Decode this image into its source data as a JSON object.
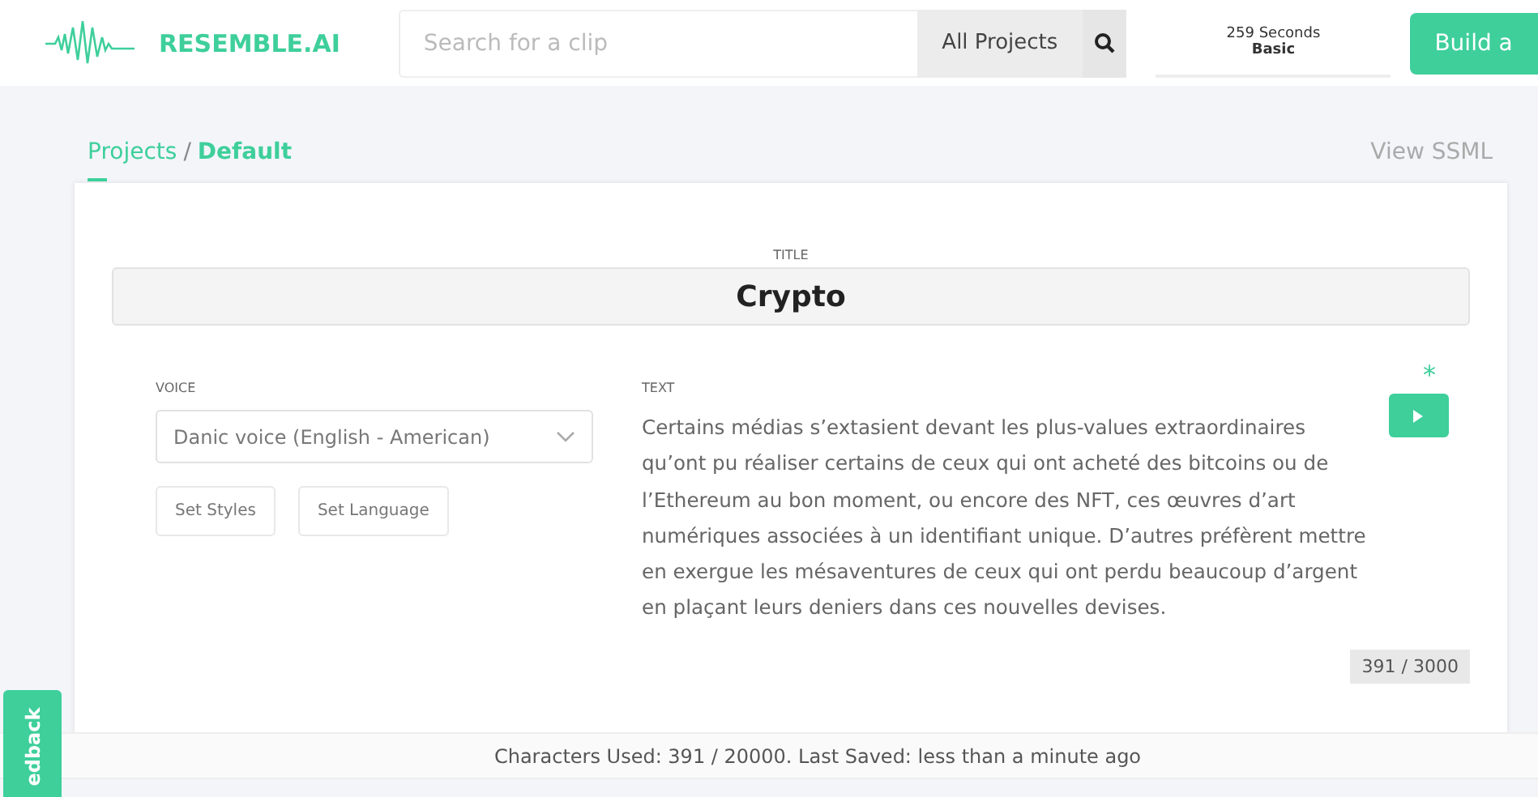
{
  "header": {
    "logo": "RESEMBLE.AI",
    "search": {
      "placeholder": "Search for a clip"
    },
    "scope": "All Projects",
    "usage": {
      "seconds": "259 Seconds",
      "plan": "Basic"
    },
    "build_button": "Build a"
  },
  "breadcrumb": {
    "parent": "Projects",
    "separator": "/",
    "current": "Default"
  },
  "view_ssml": "View SSML",
  "title": {
    "label": "TITLE",
    "value": "Crypto"
  },
  "voice": {
    "label": "VOICE",
    "value": "Danic voice (English - American)",
    "buttons": [
      "Set Styles",
      "Set Language"
    ]
  },
  "text": {
    "label": "TEXT",
    "value": "Certains médias s’extasient devant les plus-values extraordinaires qu’ont pu réaliser certains de ceux qui ont acheté des bitcoins ou de l’Ethereum au bon moment, ou encore des NFT, ces œuvres d’art numériques associées à un identifiant unique. D’autres préfèrent mettre en exergue les mésaventures de ceux qui ont perdu beaucoup d’argent en plaçant leurs deniers dans ces nouvelles devises.",
    "unsaved_mark": "*",
    "count": "391 / 3000"
  },
  "status": "Characters Used: 391 / 20000. Last Saved: less than a minute ago",
  "feedback": "edback"
}
